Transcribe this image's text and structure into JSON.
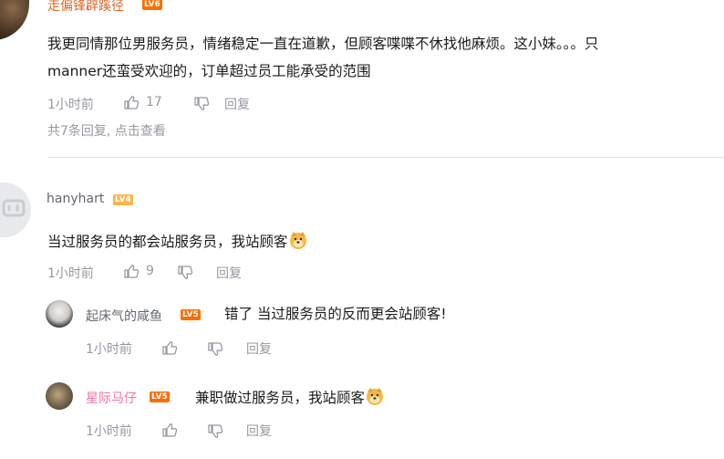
{
  "comment1": {
    "username": "走偏锋辟蹊径",
    "level": "LV6",
    "text_line1": "我更同情那位男服务员，情绪稳定一直在道歉，但顾客喋喋不休找他麻烦。这小妹。。。只",
    "text_line2": "manner还蛮受欢迎的，订单超过员工能承受的范围",
    "time": "1小时前",
    "likes": "17",
    "reply_label": "回复",
    "replies_summary": "共7条回复, 点击查看"
  },
  "comment2": {
    "username": "hanyhart",
    "level": "LV4",
    "text": "当过服务员的都会站服务员，我站顾客",
    "time": "1小时前",
    "likes": "9",
    "reply_label": "回复"
  },
  "reply1": {
    "username": "起床气的咸鱼",
    "level": "LV5",
    "text": "错了 当过服务员的反而更会站顾客!",
    "time": "1小时前",
    "reply_label": "回复"
  },
  "reply2": {
    "username": "星际马仔",
    "level": "LV5",
    "text": "兼职做过服务员，我站顾客",
    "time": "1小时前",
    "reply_label": "回复"
  },
  "colors": {
    "username_orange": "#e0662a",
    "username_pink": "#fb7299",
    "username_gray": "#61666d",
    "meta_gray": "#9499a0",
    "text": "#18191c"
  },
  "icons": [
    "thumb-up-icon",
    "thumb-down-icon",
    "doge-emoji-icon"
  ]
}
